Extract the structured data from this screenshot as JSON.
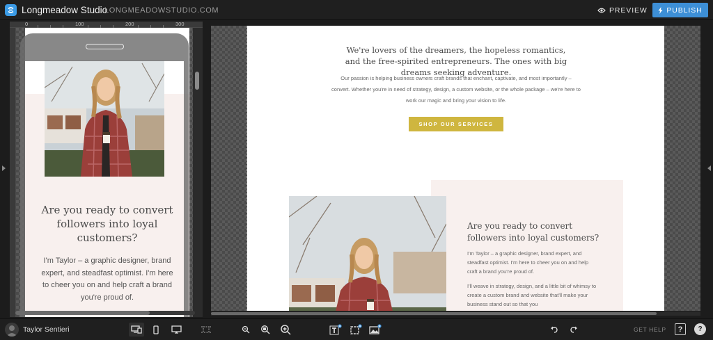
{
  "header": {
    "site_name": "Longmeadow Studio",
    "site_domain": "LONGMEADOWSTUDIO.COM",
    "preview_label": "PREVIEW",
    "publish_label": "PUBLISH"
  },
  "colors": {
    "accent": "#3d8fd6",
    "shop_button": "#cfb63f",
    "section_pink": "#f8f0ee",
    "toolbar_bg": "#1f1f1f"
  },
  "mobile_preview": {
    "ruler_ticks": [
      "0",
      "100",
      "200",
      "300"
    ],
    "heading": "Are you ready to convert followers into loyal customers?",
    "body": "I'm Taylor – a graphic designer, brand expert, and steadfast optimist. I'm here to cheer you on and help craft a brand you're proud of."
  },
  "desktop_preview": {
    "intro_serif": "We're lovers of the dreamers, the hopeless romantics, and the free-spirited entrepreneurs. The ones with big dreams seeking adventure.",
    "intro_sans": "Our passion is helping business owners craft brands that enchant, captivate, and most importantly – convert. Whether you're in need of strategy, design, a custom website, or the whole package – we're here to work our magic and bring your vision to life.",
    "shop_button": "SHOP OUR SERVICES",
    "heading": "Are you ready to convert followers into loyal customers?",
    "body1": "I'm Taylor – a graphic designer, brand expert, and steadfast optimist. I'm here to cheer you on and help craft a brand you're proud of.",
    "body2": "I'll weave in strategy, design, and a little bit of whimsy to create a custom brand and website that'll make your business stand out so that you"
  },
  "footer": {
    "user_name": "Taylor Sentieri",
    "get_help": "GET HELP",
    "help_icon_label": "?",
    "chat_icon_label": "?",
    "icons": [
      "desktop-mobile-view-icon",
      "mobile-view-icon",
      "desktop-view-icon",
      "grid-guides-icon",
      "zoom-out-icon",
      "zoom-fit-icon",
      "zoom-in-icon",
      "add-text-icon",
      "add-box-icon",
      "add-image-icon",
      "undo-icon",
      "redo-icon"
    ]
  }
}
